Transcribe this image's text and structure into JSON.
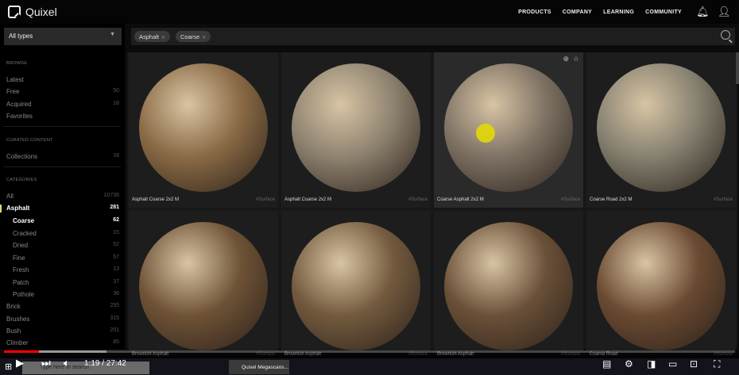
{
  "header": {
    "brand": "Quixel",
    "nav": [
      "PRODUCTS",
      "COMPANY",
      "LEARNING",
      "COMMUNITY"
    ]
  },
  "sidebar": {
    "type_select": "All types",
    "browse_title": "BROWSE",
    "browse": [
      {
        "label": "Latest",
        "count": ""
      },
      {
        "label": "Free",
        "count": "50"
      },
      {
        "label": "Acquired",
        "count": "18"
      },
      {
        "label": "Favorites",
        "count": ""
      }
    ],
    "curated_title": "CURATED CONTENT",
    "curated": [
      {
        "label": "Collections",
        "count": "18"
      }
    ],
    "categories_title": "CATEGORIES",
    "categories": [
      {
        "label": "All",
        "count": "10736"
      },
      {
        "label": "Asphalt",
        "count": "281"
      }
    ],
    "subcategories": [
      {
        "label": "Coarse",
        "count": "62"
      },
      {
        "label": "Cracked",
        "count": "15"
      },
      {
        "label": "Dried",
        "count": "52"
      },
      {
        "label": "Fine",
        "count": "57"
      },
      {
        "label": "Fresh",
        "count": "13"
      },
      {
        "label": "Patch",
        "count": "37"
      },
      {
        "label": "Pothole",
        "count": "36"
      }
    ],
    "more": [
      {
        "label": "Brick",
        "count": "255"
      },
      {
        "label": "Brushes",
        "count": "315"
      },
      {
        "label": "Bush",
        "count": "201"
      },
      {
        "label": "Climber",
        "count": "85"
      }
    ]
  },
  "search": {
    "chips": [
      "Asphalt",
      "Coarse"
    ]
  },
  "assets": [
    {
      "name": "Asphalt Coarse 2x2 M",
      "tag": "#Surface",
      "color": "#8a6a45"
    },
    {
      "name": "Asphalt Coarse 2x2 M",
      "tag": "#Surface",
      "color": "#8e8270"
    },
    {
      "name": "Coarse Asphalt 2x2 M",
      "tag": "#Surface",
      "color": "#7e7264"
    },
    {
      "name": "Coarse Road 2x2 M",
      "tag": "#Surface",
      "color": "#858070"
    },
    {
      "name": "Brownish Asphalt",
      "tag": "#Surface",
      "color": "#6e5236"
    },
    {
      "name": "Brownish Asphalt",
      "tag": "#Surface",
      "color": "#735a3e"
    },
    {
      "name": "Brownish Asphalt",
      "tag": "#Surface",
      "color": "#6a5038"
    },
    {
      "name": "Coarse Road",
      "tag": "#Surface",
      "color": "#6a4a32"
    }
  ],
  "player": {
    "time": "1:19 / 27:42",
    "progress_percent": 4.8,
    "buffered_percent": 14
  },
  "taskbar": {
    "search_placeholder": "Type here to search",
    "chrome_tab": "Quixel Megascans..."
  }
}
